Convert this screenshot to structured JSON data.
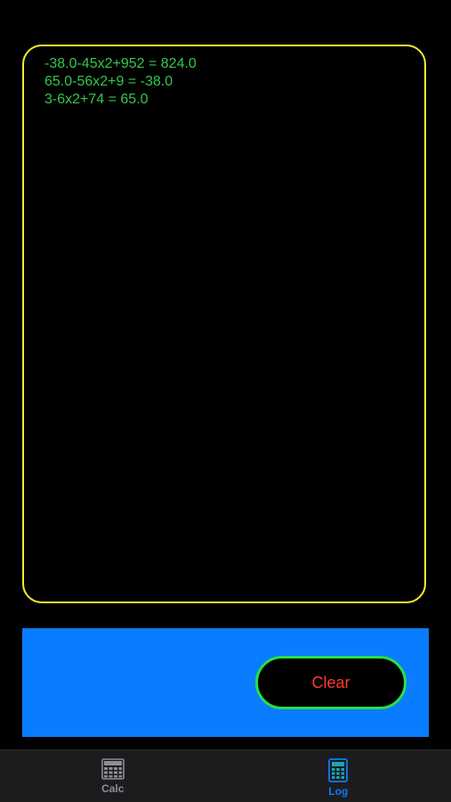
{
  "log": {
    "entries": [
      "-38.0-45x2+952 = 824.0",
      "65.0-56x2+9 = -38.0",
      "3-6x2+74 = 65.0"
    ]
  },
  "actions": {
    "clear_label": "Clear"
  },
  "tabs": [
    {
      "label": "Calc",
      "icon": "calculator-grid-icon",
      "selected": false
    },
    {
      "label": "Log",
      "icon": "calculator-icon",
      "selected": true
    }
  ],
  "colors": {
    "log_border": "#f2ee2c",
    "log_text": "#33c84c",
    "action_bar": "#0a7cff",
    "clear_border": "#27e045",
    "clear_text": "#ff3b30",
    "tab_active": "#0a7cff",
    "tab_inactive": "#8e8e93"
  }
}
